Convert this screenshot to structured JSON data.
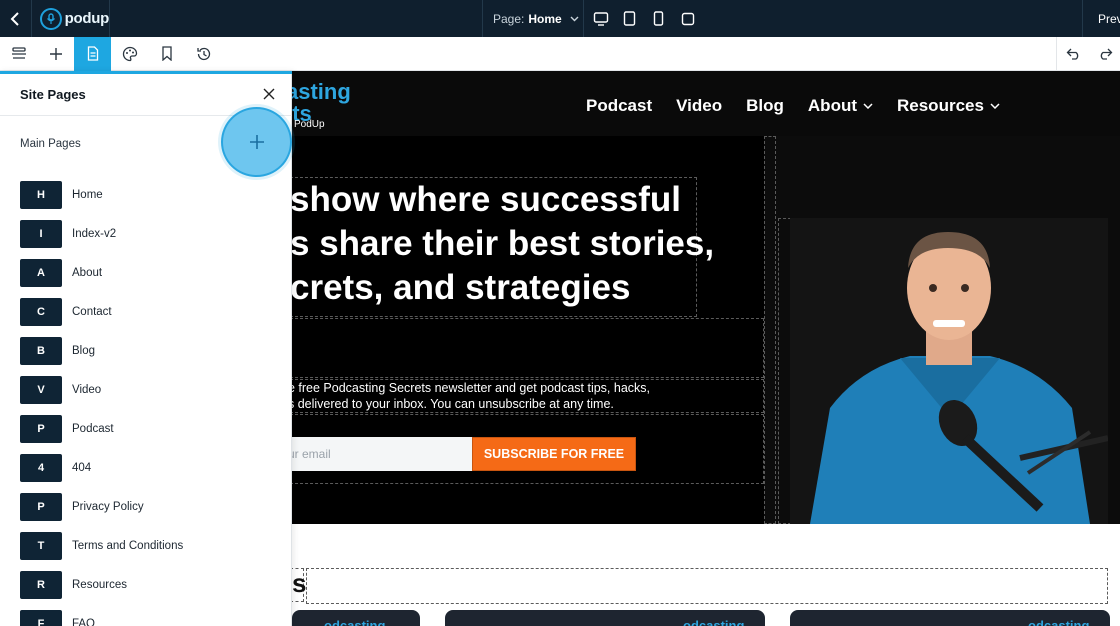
{
  "topbar": {
    "logo_text": "podup",
    "page_label": "Page:",
    "page_value": "Home",
    "preview_label": "Previ"
  },
  "canvas": {
    "brand_title": "asting",
    "brand_title_line2": "ets",
    "brand_sub": "PodUp",
    "nav": [
      {
        "label": "Podcast",
        "dropdown": false
      },
      {
        "label": "Video",
        "dropdown": false
      },
      {
        "label": "Blog",
        "dropdown": false
      },
      {
        "label": "About",
        "dropdown": true
      },
      {
        "label": "Resources",
        "dropdown": true
      }
    ],
    "hero_lines": [
      "show where successful",
      "s share their best stories,",
      "crets, and strategies"
    ],
    "body_lines": [
      "e free Podcasting Secrets newsletter and get podcast tips, hacks,",
      "s delivered to your inbox. You can unsubscribe at any time."
    ],
    "email_placeholder": "ur email",
    "subscribe_label": "SUBSCRIBE FOR FREE",
    "section2_title": "s",
    "cards": [
      "odcasting",
      "odcasting",
      "odcasting"
    ]
  },
  "panel": {
    "title": "Site Pages",
    "section_label": "Main Pages",
    "pages": [
      {
        "badge": "H",
        "name": "Home"
      },
      {
        "badge": "I",
        "name": "Index-v2"
      },
      {
        "badge": "A",
        "name": "About"
      },
      {
        "badge": "C",
        "name": "Contact"
      },
      {
        "badge": "B",
        "name": "Blog"
      },
      {
        "badge": "V",
        "name": "Video"
      },
      {
        "badge": "P",
        "name": "Podcast"
      },
      {
        "badge": "4",
        "name": "404"
      },
      {
        "badge": "P",
        "name": "Privacy Policy"
      },
      {
        "badge": "T",
        "name": "Terms and Conditions"
      },
      {
        "badge": "R",
        "name": "Resources"
      },
      {
        "badge": "F",
        "name": "FAQ"
      }
    ]
  },
  "colors": {
    "topbar_bg": "#0f1f2e",
    "accent": "#1ea7e1",
    "badge_bg": "#0f2435",
    "subscribe_bg": "#f56a16"
  }
}
